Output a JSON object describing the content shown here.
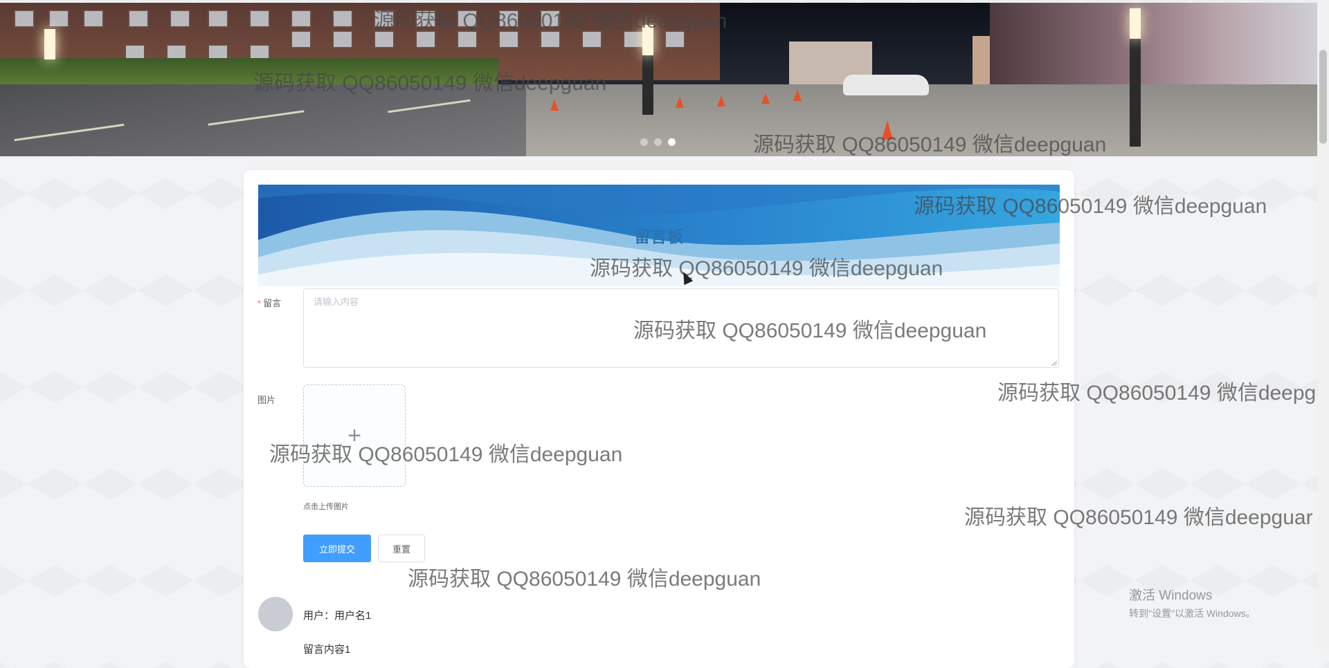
{
  "board": {
    "title": "留言板"
  },
  "form": {
    "message_label": "留言",
    "required_mark": "*",
    "message_placeholder": "请输入内容",
    "image_label": "图片",
    "upload_plus": "+",
    "upload_hint": "点击上传图片",
    "submit_label": "立即提交",
    "reset_label": "重置"
  },
  "comments": [
    {
      "user_line": "用户：用户名1",
      "content": "留言内容1"
    }
  ],
  "watermark": "源码获取 QQ86050149 微信deepguan",
  "watermark_cut": "源码获取 QQ86050149 微信deepg",
  "watermark_cut2": "源码获取 QQ86050149 微信deepguar",
  "carousel": {
    "slides": 3,
    "active": 3
  },
  "windows_activation": {
    "line1": "激活 Windows",
    "line2": "转到\"设置\"以激活 Windows。"
  },
  "colors": {
    "primary": "#409eff",
    "title": "#2a72b0"
  }
}
